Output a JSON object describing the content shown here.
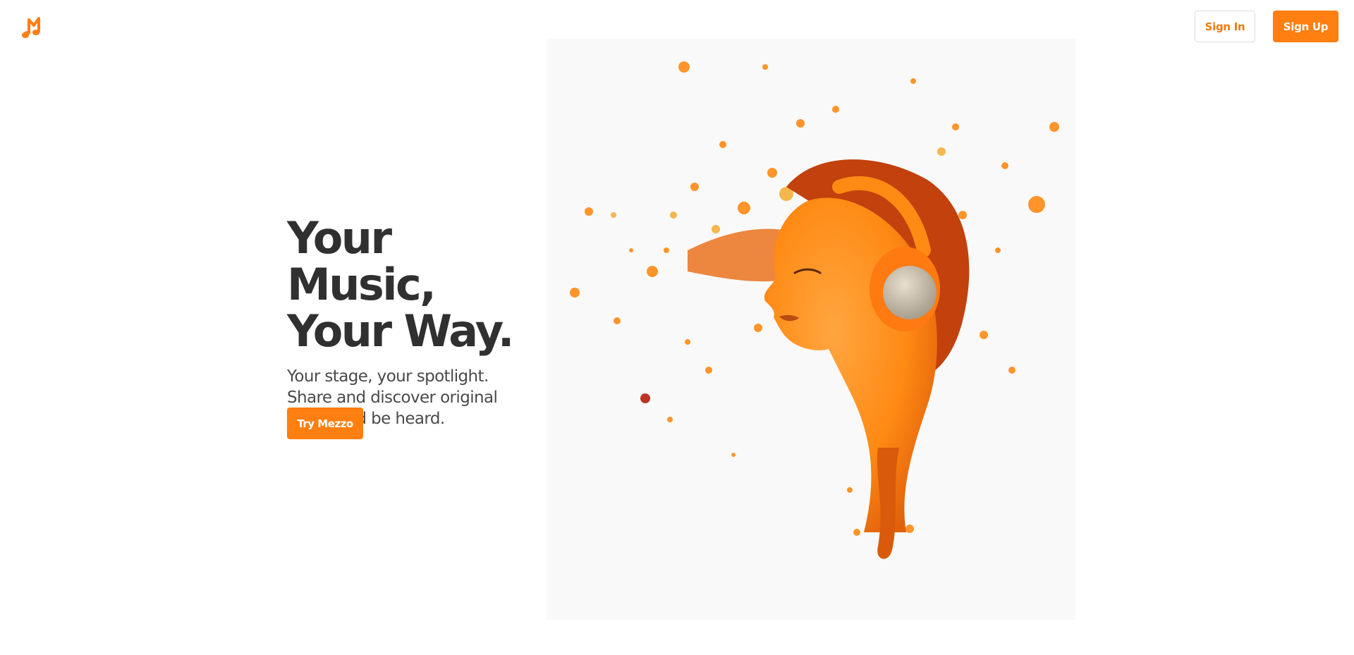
{
  "header": {
    "logo_icon": "music-note-m-icon",
    "sign_in_label": "Sign In",
    "sign_up_label": "Sign Up"
  },
  "hero": {
    "headline_line1": "Your Music,",
    "headline_line2": "Your Way.",
    "subtext": "Your stage, your spotlight. Share and discover original songs and be heard.",
    "cta_label": "Try Mezzo",
    "image_subject": "woman-with-headphones-orange-splash-illustration"
  },
  "colors": {
    "accent": "#ff7f11",
    "accent_text": "#f07a10",
    "heading": "#303030",
    "body_text": "#4a4a4a",
    "image_bg": "#f9f9f9"
  }
}
